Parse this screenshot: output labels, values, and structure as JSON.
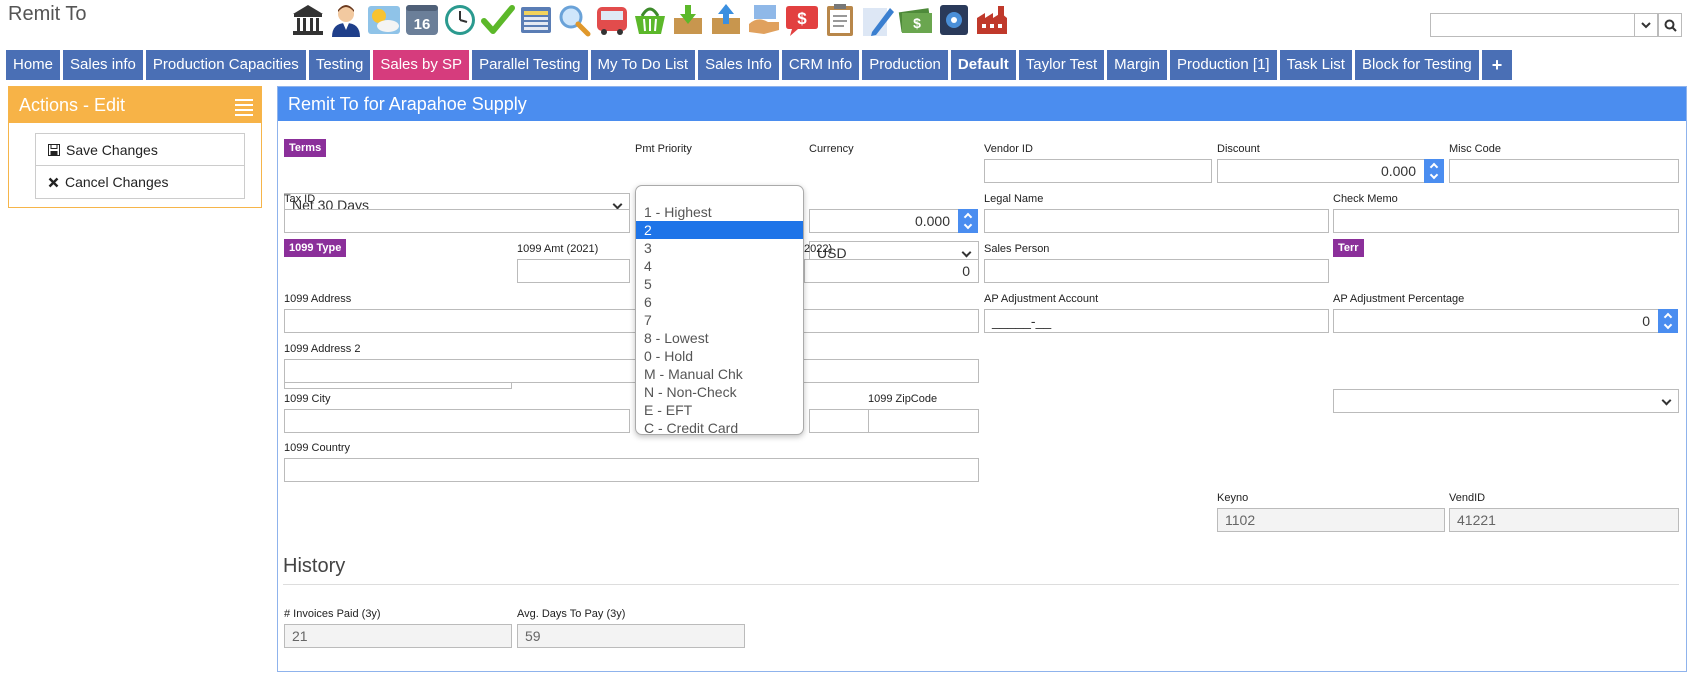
{
  "app": {
    "title": "Remit To"
  },
  "toolbar": {
    "icons": [
      "bank-icon",
      "person-icon",
      "weather-icon",
      "calendar-icon",
      "clock-icon",
      "checkmark-icon",
      "register-icon",
      "magnifier-icon",
      "truck-icon",
      "basket-icon",
      "download-box-icon",
      "upload-box-icon",
      "handshake-icon",
      "dollar-chat-icon",
      "clipboard-icon",
      "pencil-icon",
      "money-icon",
      "safe-icon",
      "factory-icon"
    ],
    "calendar_day": "16"
  },
  "search": {
    "value": ""
  },
  "tabs": [
    {
      "label": "Home",
      "style": "normal"
    },
    {
      "label": "Sales info",
      "style": "normal"
    },
    {
      "label": "Production Capacities",
      "style": "normal"
    },
    {
      "label": "Testing",
      "style": "normal"
    },
    {
      "label": "Sales by SP",
      "style": "pink"
    },
    {
      "label": "Parallel Testing",
      "style": "normal"
    },
    {
      "label": "My To Do List",
      "style": "normal"
    },
    {
      "label": "Sales Info",
      "style": "normal"
    },
    {
      "label": "CRM Info",
      "style": "normal"
    },
    {
      "label": "Production",
      "style": "normal"
    },
    {
      "label": "Default",
      "style": "bold"
    },
    {
      "label": "Taylor Test",
      "style": "normal"
    },
    {
      "label": "Margin",
      "style": "normal"
    },
    {
      "label": "Production [1]",
      "style": "normal"
    },
    {
      "label": "Task List",
      "style": "normal"
    },
    {
      "label": "Block for Testing",
      "style": "normal"
    },
    {
      "label": "+",
      "style": "plus"
    }
  ],
  "actions": {
    "title": "Actions - Edit",
    "save_label": "Save Changes",
    "cancel_label": "Cancel Changes"
  },
  "form": {
    "title": "Remit To for Arapahoe Supply",
    "terms": {
      "label": "Terms",
      "value": "Net 30 Days"
    },
    "pmt_priority": {
      "label": "Pmt Priority",
      "value": "2"
    },
    "currency": {
      "label": "Currency",
      "value": "USD"
    },
    "vendor_id": {
      "label": "Vendor ID",
      "value": ""
    },
    "discount": {
      "label": "Discount",
      "value": "0.000"
    },
    "misc_code": {
      "label": "Misc Code",
      "value": ""
    },
    "tax_id": {
      "label": "Tax ID",
      "value": ""
    },
    "hidden_amount": {
      "value": "0.000"
    },
    "legal_name": {
      "label": "Legal Name",
      "value": ""
    },
    "check_memo": {
      "label": "Check Memo",
      "value": ""
    },
    "type_1099": {
      "label": "1099 Type",
      "value": ""
    },
    "amt_2021": {
      "label": "1099 Amt (2021)",
      "value": ""
    },
    "amt_2022": {
      "label": "2022)",
      "value": "0"
    },
    "sales_person": {
      "label": "Sales Person",
      "value": ""
    },
    "terr": {
      "label": "Terr",
      "value": ""
    },
    "address_1099": {
      "label": "1099 Address",
      "value": ""
    },
    "ap_adj_account": {
      "label": "AP Adjustment Account",
      "value": "_____-__"
    },
    "ap_adj_pct": {
      "label": "AP Adjustment Percentage",
      "value": "0"
    },
    "address2_1099": {
      "label": "1099 Address 2",
      "value": ""
    },
    "city_1099": {
      "label": "1099 City",
      "value": ""
    },
    "zip_1099": {
      "label": "1099 ZipCode",
      "value": ""
    },
    "country_1099": {
      "label": "1099 Country",
      "value": ""
    },
    "keyno": {
      "label": "Keyno",
      "value": "1102"
    },
    "vendid": {
      "label": "VendID",
      "value": "41221"
    }
  },
  "history": {
    "title": "History",
    "invoices_paid": {
      "label": "# Invoices Paid (3y)",
      "value": "21"
    },
    "avg_days": {
      "label": "Avg. Days To Pay (3y)",
      "value": "59"
    }
  },
  "pmt_priority_options": [
    {
      "label": "1 - Highest",
      "selected": false
    },
    {
      "label": "2",
      "selected": true
    },
    {
      "label": "3",
      "selected": false
    },
    {
      "label": "4",
      "selected": false
    },
    {
      "label": "5",
      "selected": false
    },
    {
      "label": "6",
      "selected": false
    },
    {
      "label": "7",
      "selected": false
    },
    {
      "label": "8 - Lowest",
      "selected": false
    },
    {
      "label": "0 - Hold",
      "selected": false
    },
    {
      "label": "M - Manual Chk",
      "selected": false
    },
    {
      "label": "N - Non-Check",
      "selected": false
    },
    {
      "label": "E - EFT",
      "selected": false
    },
    {
      "label": "C - Credit Card",
      "selected": false
    }
  ]
}
